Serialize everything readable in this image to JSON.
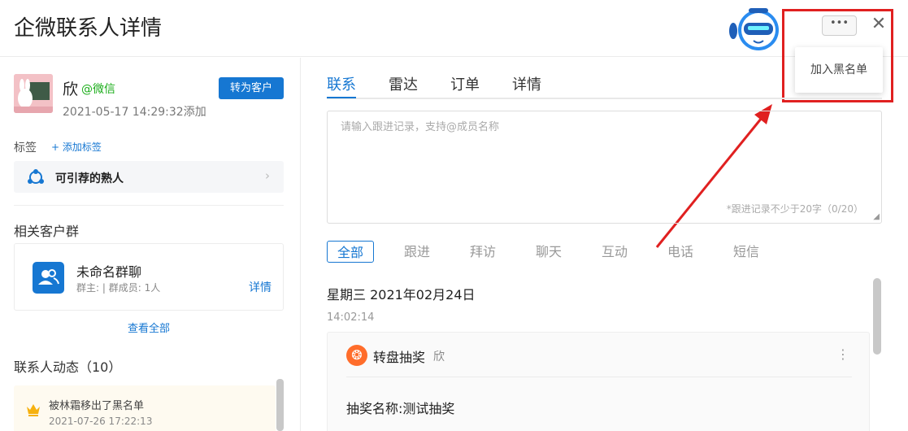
{
  "header": {
    "title": "企微联系人详情",
    "more_label": "•••",
    "close_label": "✕"
  },
  "menu": {
    "items": [
      {
        "label": "加入黑名单"
      }
    ]
  },
  "customer": {
    "name": "欣",
    "source": "@微信",
    "added_time": "2021-05-17 14:29:32添加",
    "convert_label": "转为客户"
  },
  "tags": {
    "label": "标签",
    "add_label": "+ 添加标签",
    "items": [
      {
        "label": "可引荐的熟人"
      }
    ]
  },
  "groups": {
    "title": "相关客户群",
    "items": [
      {
        "name": "未命名群聊",
        "meta": "群主: | 群成员: 1人",
        "detail_label": "详情"
      }
    ],
    "view_all": "查看全部"
  },
  "activity": {
    "title": "联系人动态（10）",
    "items": [
      {
        "text": "被林霜移出了黑名单",
        "time": "2021-07-26 17:22:13"
      }
    ]
  },
  "tabs": [
    {
      "label": "联系",
      "active": true
    },
    {
      "label": "雷达"
    },
    {
      "label": "订单"
    },
    {
      "label": "详情"
    }
  ],
  "followup": {
    "placeholder": "请输入跟进记录，支持@成员名称",
    "counter": "*跟进记录不少于20字（0/20）"
  },
  "filters": [
    {
      "label": "全部",
      "active": true
    },
    {
      "label": "跟进"
    },
    {
      "label": "拜访"
    },
    {
      "label": "聊天"
    },
    {
      "label": "互动"
    },
    {
      "label": "电话"
    },
    {
      "label": "短信"
    }
  ],
  "timeline": {
    "date": "星期三   2021年02月24日",
    "time": "14:02:14",
    "event": {
      "title": "转盘抽奖",
      "user": "欣",
      "more": "⋮",
      "body": "抽奖名称:测试抽奖"
    }
  },
  "colors": {
    "primary": "#1677d2",
    "wechat_green": "#1aad19",
    "highlight_red": "#e02020",
    "event_orange": "#ff6d2b"
  },
  "icons": {
    "robot": "robot-mascot-icon",
    "tag": "share-nodes-icon",
    "group": "group-users-icon",
    "activity": "crown-icon",
    "event": "wheel-icon"
  }
}
